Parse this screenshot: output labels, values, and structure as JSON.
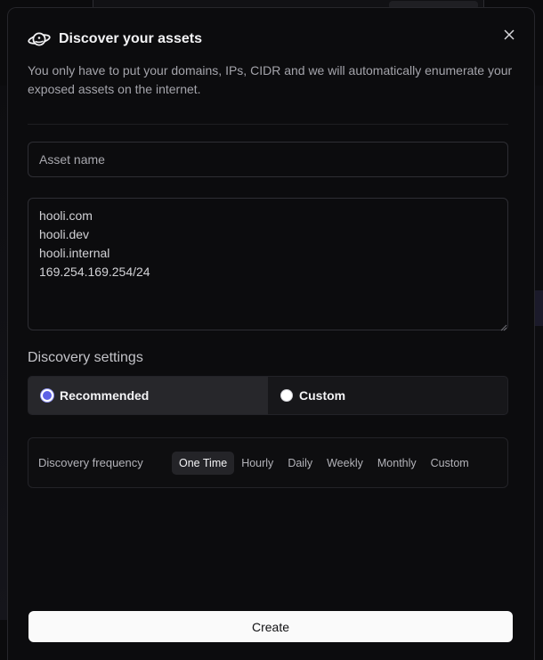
{
  "modal": {
    "title": "Discover your assets",
    "description": "You only have to put your domains, IPs, CIDR and we will automatically enumerate your exposed assets on the internet.",
    "logo_icon": "planet-icon",
    "close_icon": "close-icon"
  },
  "form": {
    "asset_name": {
      "placeholder": "Asset name",
      "value": ""
    },
    "targets": {
      "value": "hooli.com\nhooli.dev\nhooli.internal\n169.254.169.254/24"
    }
  },
  "discovery_settings": {
    "title": "Discovery settings",
    "options": [
      {
        "label": "Recommended",
        "selected": true
      },
      {
        "label": "Custom",
        "selected": false
      }
    ],
    "accent_color": "#5d61e6"
  },
  "frequency": {
    "label": "Discovery frequency",
    "options": [
      "One Time",
      "Hourly",
      "Daily",
      "Weekly",
      "Monthly",
      "Custom"
    ],
    "selected": "One Time"
  },
  "actions": {
    "create_label": "Create"
  }
}
